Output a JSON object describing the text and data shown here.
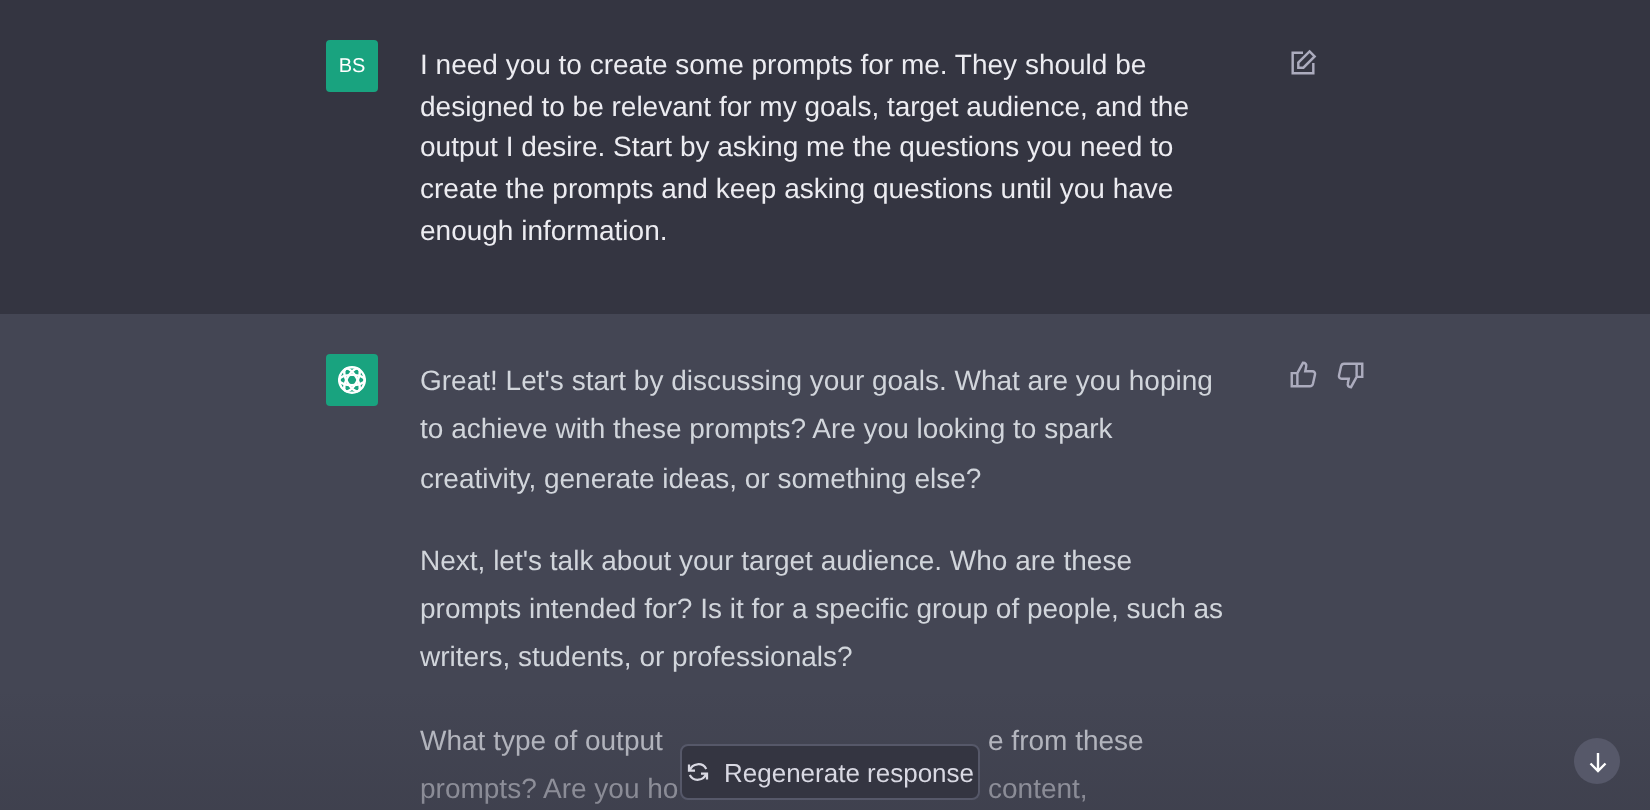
{
  "user_message": {
    "avatar": "BS",
    "text": "I need you to create some prompts for me. They should be designed to be relevant for my goals, target audience, and the output I desire. Start by asking me the questions you need to create the prompts and keep asking questions until you have enough information."
  },
  "assistant_message": {
    "paragraphs": [
      "Great! Let's start by discussing your goals. What are you hoping to achieve with these prompts? Are you looking to spark creativity, generate ideas, or something else?",
      "Next, let's talk about your target audience. Who are these prompts intended for? Is it for a specific group of people, such as writers, students, or professionals?"
    ],
    "cut_paragraph": {
      "lines": [
        [
          "What type of output",
          "e from these"
        ],
        [
          "prompts? Are you ho",
          "content,"
        ]
      ]
    }
  },
  "regenerate_button": {
    "label": "Regenerate response"
  }
}
